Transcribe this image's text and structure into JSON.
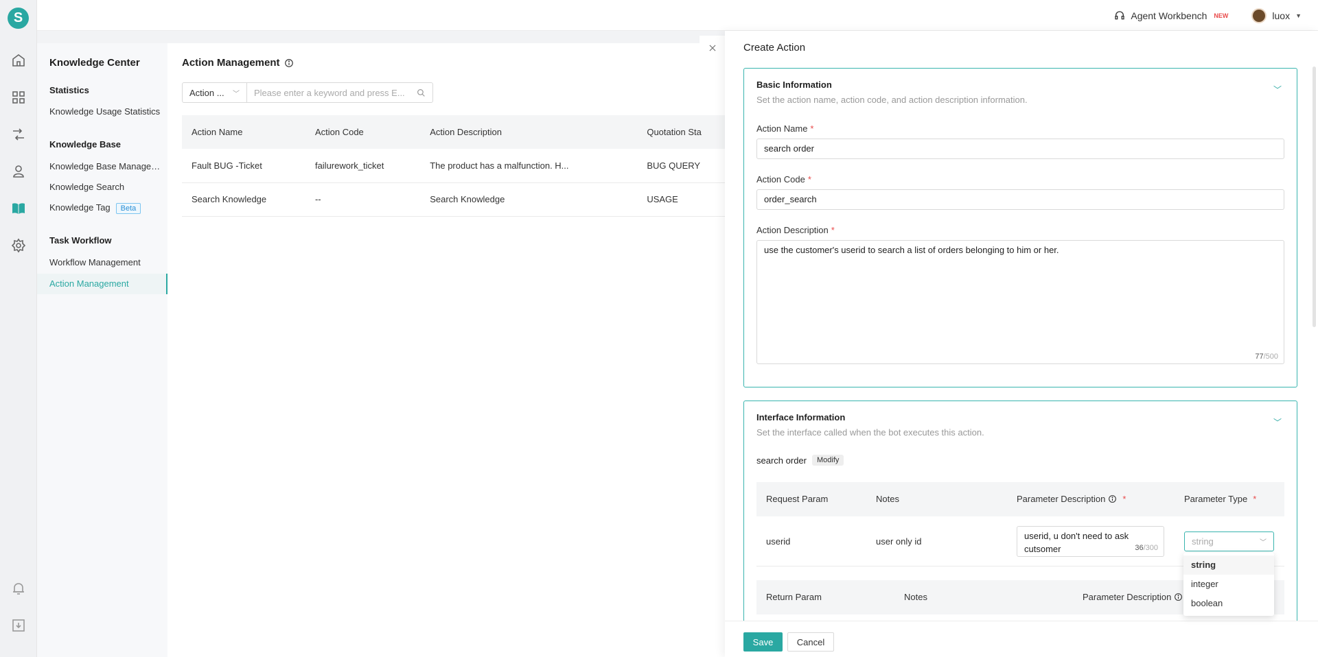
{
  "app": {
    "logo_letter": "S"
  },
  "topbar": {
    "workbench_label": "Agent Workbench",
    "workbench_badge": "NEW",
    "user_name": "luox"
  },
  "sidebar": {
    "title": "Knowledge Center",
    "sections": [
      {
        "title": "Statistics",
        "items": [
          "Knowledge Usage Statistics"
        ]
      },
      {
        "title": "Knowledge Base",
        "items": [
          "Knowledge Base Management",
          "Knowledge Search",
          "Knowledge Tag"
        ]
      },
      {
        "title": "Task Workflow",
        "items": [
          "Workflow Management",
          "Action Management"
        ]
      }
    ],
    "beta_label": "Beta"
  },
  "main": {
    "title": "Action Management",
    "filter_select": "Action ...",
    "search_placeholder": "Please enter a keyword and press E...",
    "columns": [
      "Action Name",
      "Action Code",
      "Action Description",
      "Quotation Sta"
    ],
    "rows": [
      {
        "name": "Fault BUG -Ticket",
        "code": "failurework_ticket",
        "desc": "The product has a malfunction. H...",
        "quote": "BUG QUERY"
      },
      {
        "name": "Search Knowledge",
        "code": "--",
        "desc": "Search Knowledge",
        "quote": "USAGE"
      }
    ]
  },
  "drawer": {
    "title": "Create Action",
    "basic": {
      "title": "Basic Information",
      "desc": "Set the action name, action code, and action description information.",
      "name_label": "Action Name",
      "name_value": "search order",
      "code_label": "Action Code",
      "code_value": "order_search",
      "desc_label": "Action Description",
      "desc_value": "use the customer's userid to search a list of orders belonging to him or her.",
      "desc_count": "77",
      "desc_max": "/500"
    },
    "interface": {
      "title": "Interface Information",
      "desc": "Set the interface called when the bot executes this action.",
      "interface_name": "search order",
      "modify_label": "Modify",
      "request_columns": [
        "Request Param",
        "Notes",
        "Parameter Description",
        "Parameter Type"
      ],
      "request_row": {
        "param": "userid",
        "notes": "user only id",
        "desc": "userid, u don't need to ask cutsomer",
        "count": "36",
        "max": "/300",
        "type_placeholder": "string"
      },
      "return_columns": [
        "Return Param",
        "Notes",
        "Parameter Description"
      ]
    },
    "type_options": [
      "string",
      "integer",
      "boolean"
    ],
    "save_label": "Save",
    "cancel_label": "Cancel"
  },
  "colors": {
    "accent": "#2aa8a2",
    "required": "#e94b4b"
  }
}
